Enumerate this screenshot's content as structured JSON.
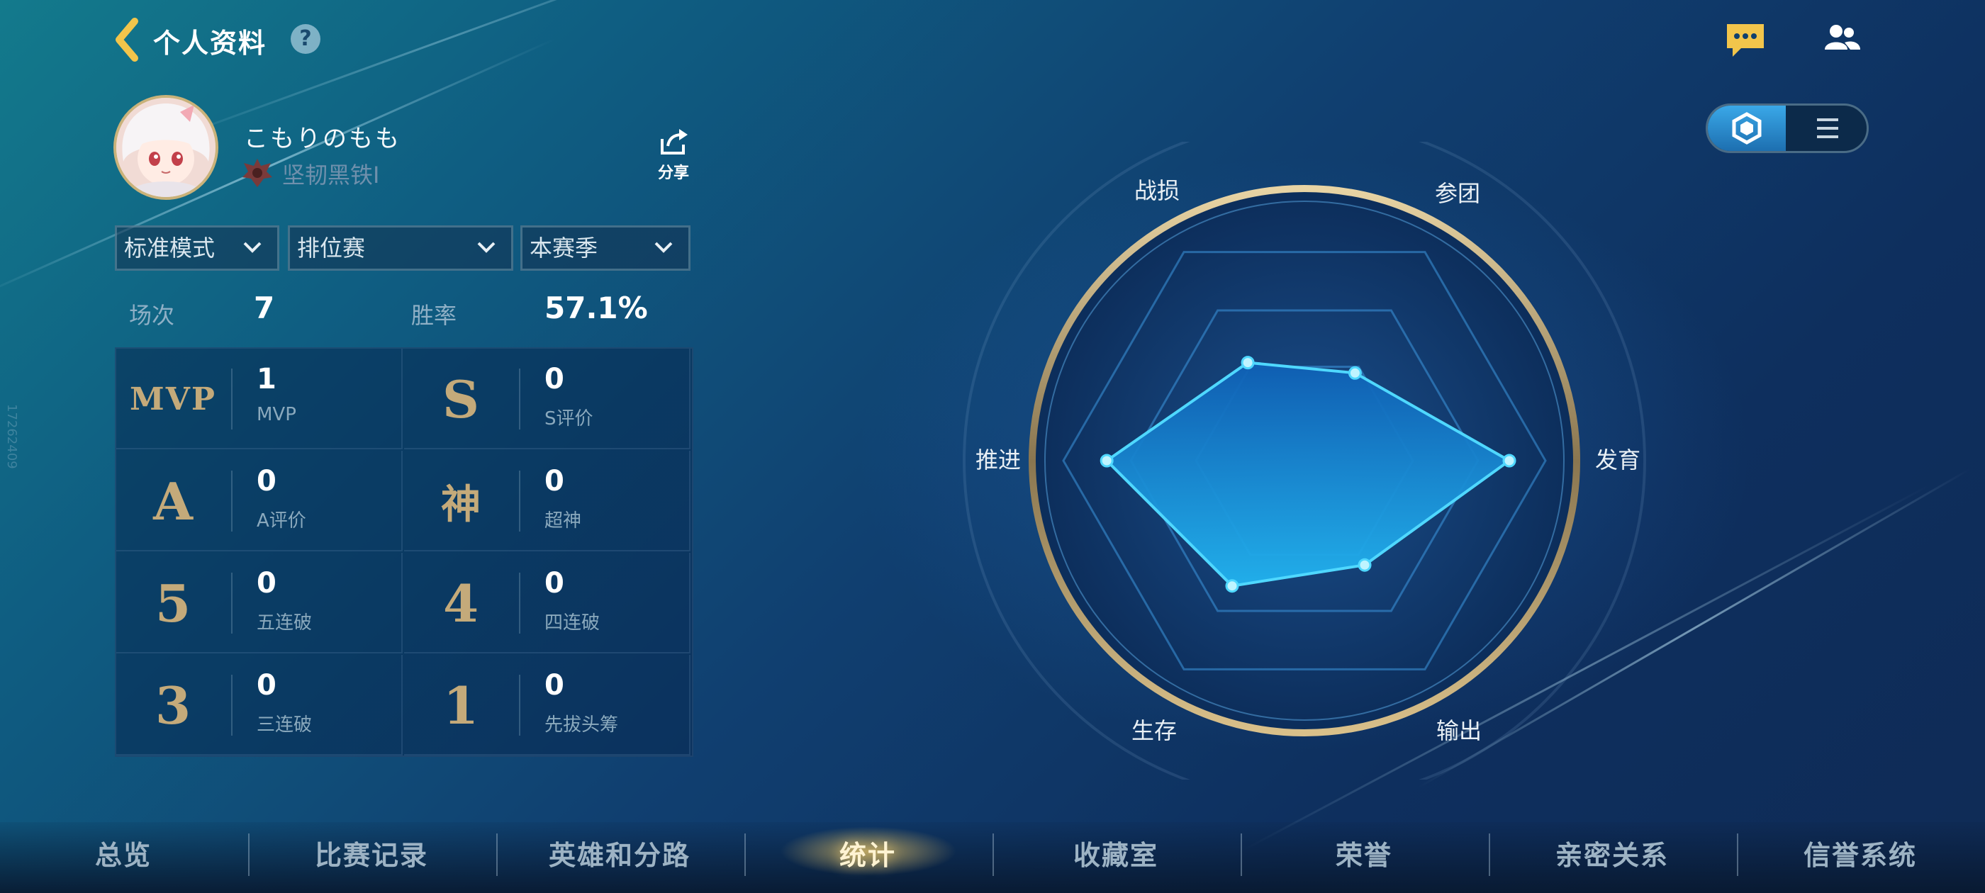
{
  "header": {
    "title": "个人资料",
    "help_glyph": "?"
  },
  "profile": {
    "username": "こもりのもも",
    "rank": "坚韧黑铁I",
    "share_label": "分享"
  },
  "filters": [
    {
      "label": "标准模式"
    },
    {
      "label": "排位赛"
    },
    {
      "label": "本赛季"
    }
  ],
  "summary": {
    "matches_label": "场次",
    "matches_value": "7",
    "winrate_label": "胜率",
    "winrate_value": "57.1%"
  },
  "stats": [
    {
      "badge": "MVP",
      "value": "1",
      "label": "MVP"
    },
    {
      "badge": "S",
      "value": "0",
      "label": "S评价"
    },
    {
      "badge": "A",
      "value": "0",
      "label": "A评价"
    },
    {
      "badge": "神",
      "value": "0",
      "label": "超神"
    },
    {
      "badge": "5",
      "value": "0",
      "label": "五连破"
    },
    {
      "badge": "4",
      "value": "0",
      "label": "四连破"
    },
    {
      "badge": "3",
      "value": "0",
      "label": "三连破"
    },
    {
      "badge": "1",
      "value": "0",
      "label": "先拔头筹"
    }
  ],
  "radar": {
    "axes": [
      "战损",
      "参团",
      "发育",
      "输出",
      "生存",
      "推进"
    ],
    "values": [
      0.47,
      0.42,
      0.85,
      0.5,
      0.6,
      0.82
    ],
    "fill_color": "#1c9be6",
    "line_color": "#4fd8ff"
  },
  "view_toggle": {
    "selected": "radar-view",
    "icons": [
      "hexagon-icon",
      "list-icon"
    ]
  },
  "nav": {
    "tabs": [
      "总览",
      "比赛记录",
      "英雄和分路",
      "统计",
      "收藏室",
      "荣誉",
      "亲密关系",
      "信誉系统"
    ],
    "active_index": 3
  },
  "side_id": "17262409"
}
